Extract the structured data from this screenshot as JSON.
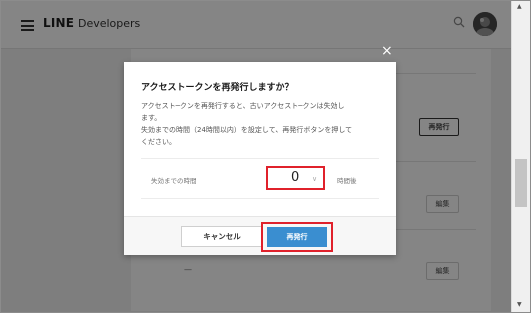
{
  "header": {
    "brand_strong": "LINE",
    "brand_light": "Developers"
  },
  "background": {
    "reissue_button": "再発行",
    "edit_button_1": "編集",
    "edit_button_2": "編集",
    "dash": "—"
  },
  "modal": {
    "close": "×",
    "title": "アクセストークンを再発行しますか？",
    "description_lines": [
      "アクセスト─クンを再発行すると、古いアクセスト─クンは失効し",
      "ます。",
      "失効までの時間（24時間以内）を設定して、再発行ボタンを押して",
      "ください。"
    ],
    "field_label": "失効までの時間",
    "hours_value": "0",
    "unit_label": "時間後",
    "cancel_label": "キャンセル",
    "reissue_label": "再発行"
  },
  "colors": {
    "highlight": "#e0212b",
    "primary": "#3a8ed0"
  },
  "icons": {
    "menu": "hamburger-icon",
    "search": "search-icon",
    "user": "avatar",
    "dropdown": "chevron-down-icon"
  }
}
